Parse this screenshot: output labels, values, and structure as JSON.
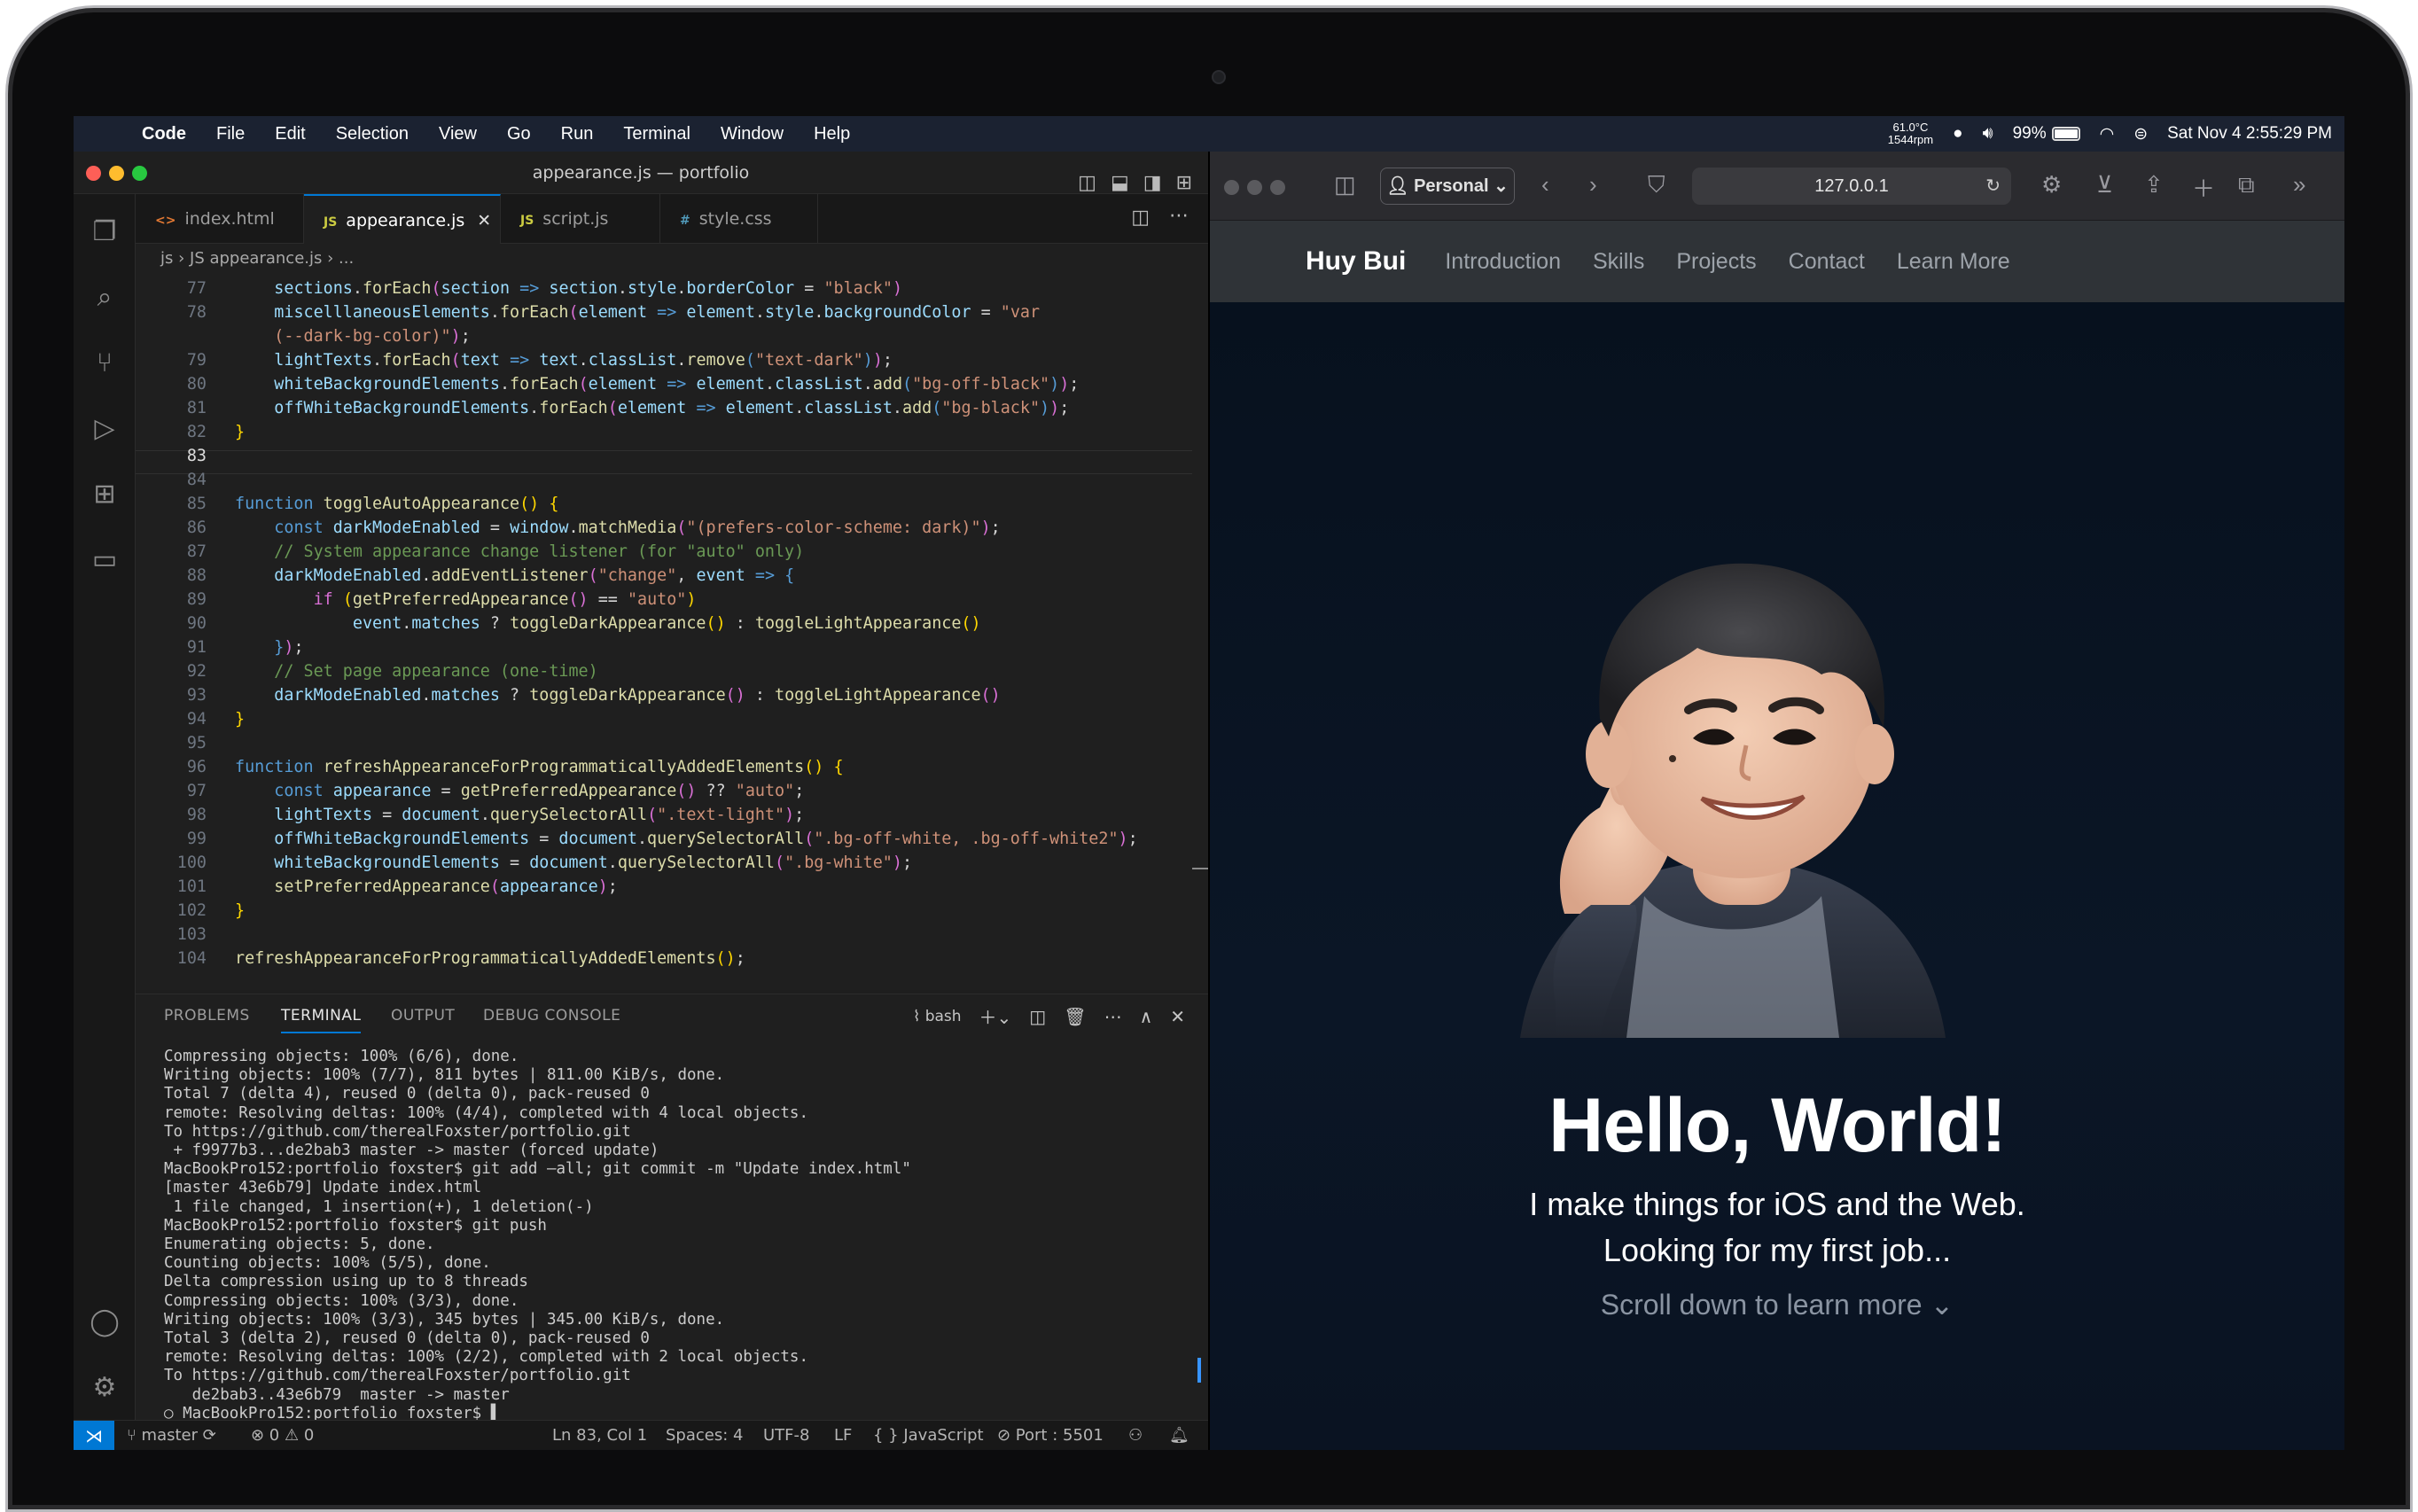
{
  "menubar": {
    "app": "Code",
    "items": [
      "File",
      "Edit",
      "Selection",
      "View",
      "Go",
      "Run",
      "Terminal",
      "Window",
      "Help"
    ],
    "cpu_temp": "61.0°C",
    "fan": "1544rpm",
    "battery": "99%",
    "datetime": "Sat Nov 4  2:55:29 PM"
  },
  "vscode": {
    "title": "appearance.js — portfolio",
    "tabs": [
      "index.html",
      "appearance.js",
      "script.js",
      "style.css"
    ],
    "tab_icons": [
      "<>",
      "JS",
      "JS",
      "#"
    ],
    "breadcrumb": "js › JS appearance.js › ...",
    "line_numbers": [
      "77",
      "78",
      "",
      "79",
      "80",
      "81",
      "82",
      "83",
      "84",
      "85",
      "86",
      "87",
      "88",
      "89",
      "90",
      "91",
      "92",
      "93",
      "94",
      "95",
      "96",
      "97",
      "98",
      "99",
      "100",
      "101",
      "102",
      "103",
      "104"
    ],
    "panel_tabs": [
      "PROBLEMS",
      "TERMINAL",
      "OUTPUT",
      "DEBUG CONSOLE"
    ],
    "shell": "bash",
    "terminal": [
      "Compressing objects: 100% (6/6), done.",
      "Writing objects: 100% (7/7), 811 bytes | 811.00 KiB/s, done.",
      "Total 7 (delta 4), reused 0 (delta 0), pack-reused 0",
      "remote: Resolving deltas: 100% (4/4), completed with 4 local objects.",
      "To https://github.com/therealFoxster/portfolio.git",
      " + f9977b3...de2bab3 master -> master (forced update)",
      "MacBookPro152:portfolio foxster$ git add —all; git commit -m \"Update index.html\"",
      "[master 43e6b79] Update index.html",
      " 1 file changed, 1 insertion(+), 1 deletion(-)",
      "MacBookPro152:portfolio foxster$ git push",
      "Enumerating objects: 5, done.",
      "Counting objects: 100% (5/5), done.",
      "Delta compression using up to 8 threads",
      "Compressing objects: 100% (3/3), done.",
      "Writing objects: 100% (3/3), 345 bytes | 345.00 KiB/s, done.",
      "Total 3 (delta 2), reused 0 (delta 0), pack-reused 0",
      "remote: Resolving deltas: 100% (2/2), completed with 2 local objects.",
      "To https://github.com/therealFoxster/portfolio.git",
      "   de2bab3..43e6b79  master -> master",
      "○ MacBookPro152:portfolio foxster$ ▌"
    ],
    "status": {
      "branch": "master",
      "problems": "⊗ 0 ⚠ 0",
      "position": "Ln 83, Col 1",
      "spaces": "Spaces: 4",
      "encoding": "UTF-8",
      "eol": "LF",
      "language": "{ } JavaScript",
      "port": "⊘ Port : 5501"
    }
  },
  "safari": {
    "profile": "Personal",
    "url": "127.0.0.1"
  },
  "site": {
    "brand": "Huy Bui",
    "nav": [
      "Introduction",
      "Skills",
      "Projects",
      "Contact",
      "Learn More"
    ],
    "headline": "Hello, World!",
    "line1": "I make things for iOS and the Web.",
    "line2": "Looking for my first job...",
    "scroll": "Scroll down to learn more ⌄"
  }
}
